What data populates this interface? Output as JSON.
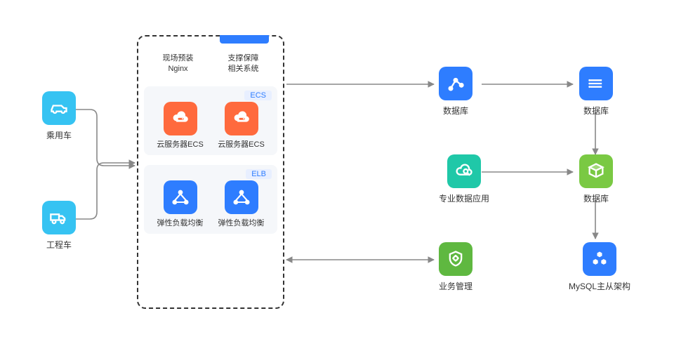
{
  "left_nodes": [
    {
      "key": "car",
      "label": "乘用车"
    },
    {
      "key": "truck",
      "label": "工程车"
    }
  ],
  "panel": {
    "head": [
      {
        "line1": "现场预装",
        "line2": "Nginx"
      },
      {
        "line1": "支撑保障",
        "line2": "相关系统"
      }
    ],
    "ecs": {
      "badge": "ECS",
      "items": [
        {
          "label": "云服务器ECS"
        },
        {
          "label": "云服务器ECS"
        }
      ]
    },
    "elb": {
      "badge": "ELB",
      "items": [
        {
          "label": "弹性负载均衡"
        },
        {
          "label": "弹性负载均衡"
        }
      ]
    }
  },
  "right_nodes": {
    "topline_a": {
      "label": "数据库"
    },
    "topline_b": {
      "label": "数据库"
    },
    "mid_left": {
      "label": "专业数据应用"
    },
    "mid_right": {
      "label": "数据库"
    },
    "bot_left": {
      "label": "业务管理"
    },
    "bot_right": {
      "label": "MySQL主从架构"
    }
  }
}
